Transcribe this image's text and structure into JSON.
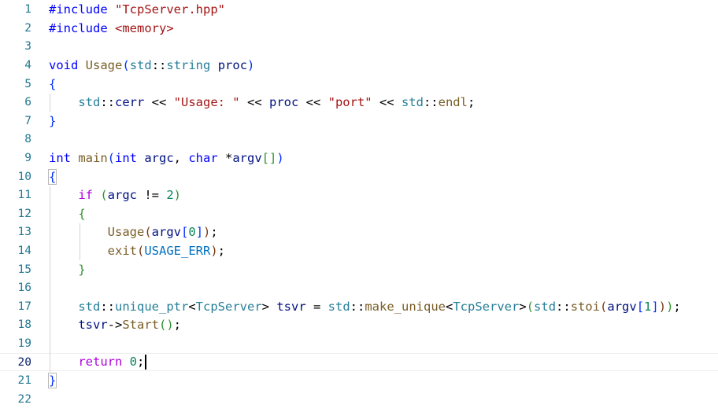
{
  "editor": {
    "language": "cpp",
    "current_line": 20,
    "lines": [
      {
        "n": "1",
        "text": "#include \"TcpServer.hpp\""
      },
      {
        "n": "2",
        "text": "#include <memory>"
      },
      {
        "n": "3",
        "text": ""
      },
      {
        "n": "4",
        "text": "void Usage(std::string proc)"
      },
      {
        "n": "5",
        "text": "{"
      },
      {
        "n": "6",
        "text": "    std::cerr << \"Usage: \" << proc << \"port\" << std::endl;"
      },
      {
        "n": "7",
        "text": "}"
      },
      {
        "n": "8",
        "text": ""
      },
      {
        "n": "9",
        "text": "int main(int argc, char *argv[])"
      },
      {
        "n": "10",
        "text": "{"
      },
      {
        "n": "11",
        "text": "    if (argc != 2)"
      },
      {
        "n": "12",
        "text": "    {"
      },
      {
        "n": "13",
        "text": "        Usage(argv[0]);"
      },
      {
        "n": "14",
        "text": "        exit(USAGE_ERR);"
      },
      {
        "n": "15",
        "text": "    }"
      },
      {
        "n": "16",
        "text": ""
      },
      {
        "n": "17",
        "text": "    std::unique_ptr<TcpServer> tsvr = std::make_unique<TcpServer>(std::stoi(argv[1]));"
      },
      {
        "n": "18",
        "text": "    tsvr->Start();"
      },
      {
        "n": "19",
        "text": ""
      },
      {
        "n": "20",
        "text": "    return 0;"
      },
      {
        "n": "21",
        "text": "}"
      },
      {
        "n": "22",
        "text": ""
      }
    ]
  },
  "tokens": {
    "l1": [
      {
        "c": "pp",
        "t": "#include "
      },
      {
        "c": "str",
        "t": "\"TcpServer.hpp\""
      }
    ],
    "l2": [
      {
        "c": "pp",
        "t": "#include "
      },
      {
        "c": "str",
        "t": "<memory>"
      }
    ],
    "l4": [
      {
        "c": "kw",
        "t": "void "
      },
      {
        "c": "fn",
        "t": "Usage"
      },
      {
        "c": "b1",
        "t": "("
      },
      {
        "c": "ty",
        "t": "std"
      },
      {
        "c": "op",
        "t": "::"
      },
      {
        "c": "ty",
        "t": "string"
      },
      {
        "c": "op",
        "t": " "
      },
      {
        "c": "var",
        "t": "proc"
      },
      {
        "c": "b1",
        "t": ")"
      }
    ],
    "l5": [
      {
        "c": "b1",
        "t": "{"
      }
    ],
    "l6": [
      {
        "c": "op",
        "t": "    "
      },
      {
        "c": "ty",
        "t": "std"
      },
      {
        "c": "op",
        "t": "::"
      },
      {
        "c": "var",
        "t": "cerr"
      },
      {
        "c": "op",
        "t": " << "
      },
      {
        "c": "str",
        "t": "\"Usage: \""
      },
      {
        "c": "op",
        "t": " << "
      },
      {
        "c": "var",
        "t": "proc"
      },
      {
        "c": "op",
        "t": " << "
      },
      {
        "c": "str",
        "t": "\"port\""
      },
      {
        "c": "op",
        "t": " << "
      },
      {
        "c": "ty",
        "t": "std"
      },
      {
        "c": "op",
        "t": "::"
      },
      {
        "c": "fn",
        "t": "endl"
      },
      {
        "c": "op",
        "t": ";"
      }
    ],
    "l7": [
      {
        "c": "b1",
        "t": "}"
      }
    ],
    "l9": [
      {
        "c": "kw",
        "t": "int "
      },
      {
        "c": "fn",
        "t": "main"
      },
      {
        "c": "b1",
        "t": "("
      },
      {
        "c": "kw",
        "t": "int "
      },
      {
        "c": "var",
        "t": "argc"
      },
      {
        "c": "op",
        "t": ", "
      },
      {
        "c": "kw",
        "t": "char "
      },
      {
        "c": "op",
        "t": "*"
      },
      {
        "c": "var",
        "t": "argv"
      },
      {
        "c": "b2",
        "t": "[]"
      },
      {
        "c": "b1",
        "t": ")"
      }
    ],
    "l10": [
      {
        "c": "b1 brbox",
        "t": "{"
      }
    ],
    "l11": [
      {
        "c": "op",
        "t": "    "
      },
      {
        "c": "kw2",
        "t": "if "
      },
      {
        "c": "b2",
        "t": "("
      },
      {
        "c": "var",
        "t": "argc"
      },
      {
        "c": "op",
        "t": " != "
      },
      {
        "c": "num",
        "t": "2"
      },
      {
        "c": "b2",
        "t": ")"
      }
    ],
    "l12": [
      {
        "c": "op",
        "t": "    "
      },
      {
        "c": "b2",
        "t": "{"
      }
    ],
    "l13": [
      {
        "c": "op",
        "t": "        "
      },
      {
        "c": "fn",
        "t": "Usage"
      },
      {
        "c": "b3",
        "t": "("
      },
      {
        "c": "var",
        "t": "argv"
      },
      {
        "c": "b1",
        "t": "["
      },
      {
        "c": "num",
        "t": "0"
      },
      {
        "c": "b1",
        "t": "]"
      },
      {
        "c": "b3",
        "t": ")"
      },
      {
        "c": "op",
        "t": ";"
      }
    ],
    "l14": [
      {
        "c": "op",
        "t": "        "
      },
      {
        "c": "fn",
        "t": "exit"
      },
      {
        "c": "b3",
        "t": "("
      },
      {
        "c": "en",
        "t": "USAGE_ERR"
      },
      {
        "c": "b3",
        "t": ")"
      },
      {
        "c": "op",
        "t": ";"
      }
    ],
    "l15": [
      {
        "c": "op",
        "t": "    "
      },
      {
        "c": "b2",
        "t": "}"
      }
    ],
    "l17": [
      {
        "c": "op",
        "t": "    "
      },
      {
        "c": "ty",
        "t": "std"
      },
      {
        "c": "op",
        "t": "::"
      },
      {
        "c": "ty",
        "t": "unique_ptr"
      },
      {
        "c": "op",
        "t": "<"
      },
      {
        "c": "ty",
        "t": "TcpServer"
      },
      {
        "c": "op",
        "t": "> "
      },
      {
        "c": "var",
        "t": "tsvr"
      },
      {
        "c": "op",
        "t": " = "
      },
      {
        "c": "ty",
        "t": "std"
      },
      {
        "c": "op",
        "t": "::"
      },
      {
        "c": "fn",
        "t": "make_unique"
      },
      {
        "c": "op",
        "t": "<"
      },
      {
        "c": "ty",
        "t": "TcpServer"
      },
      {
        "c": "op",
        "t": ">"
      },
      {
        "c": "b2",
        "t": "("
      },
      {
        "c": "ty",
        "t": "std"
      },
      {
        "c": "op",
        "t": "::"
      },
      {
        "c": "fn",
        "t": "stoi"
      },
      {
        "c": "b3",
        "t": "("
      },
      {
        "c": "var",
        "t": "argv"
      },
      {
        "c": "b1",
        "t": "["
      },
      {
        "c": "num",
        "t": "1"
      },
      {
        "c": "b1",
        "t": "]"
      },
      {
        "c": "b3",
        "t": ")"
      },
      {
        "c": "b2",
        "t": ")"
      },
      {
        "c": "op",
        "t": ";"
      }
    ],
    "l18": [
      {
        "c": "op",
        "t": "    "
      },
      {
        "c": "var",
        "t": "tsvr"
      },
      {
        "c": "op",
        "t": "->"
      },
      {
        "c": "fn",
        "t": "Start"
      },
      {
        "c": "b2",
        "t": "()"
      },
      {
        "c": "op",
        "t": ";"
      }
    ],
    "l20": [
      {
        "c": "op",
        "t": "    "
      },
      {
        "c": "kw2",
        "t": "return "
      },
      {
        "c": "num",
        "t": "0"
      },
      {
        "c": "op",
        "t": ";"
      }
    ],
    "l21": [
      {
        "c": "b1 brbox",
        "t": "}"
      }
    ]
  }
}
